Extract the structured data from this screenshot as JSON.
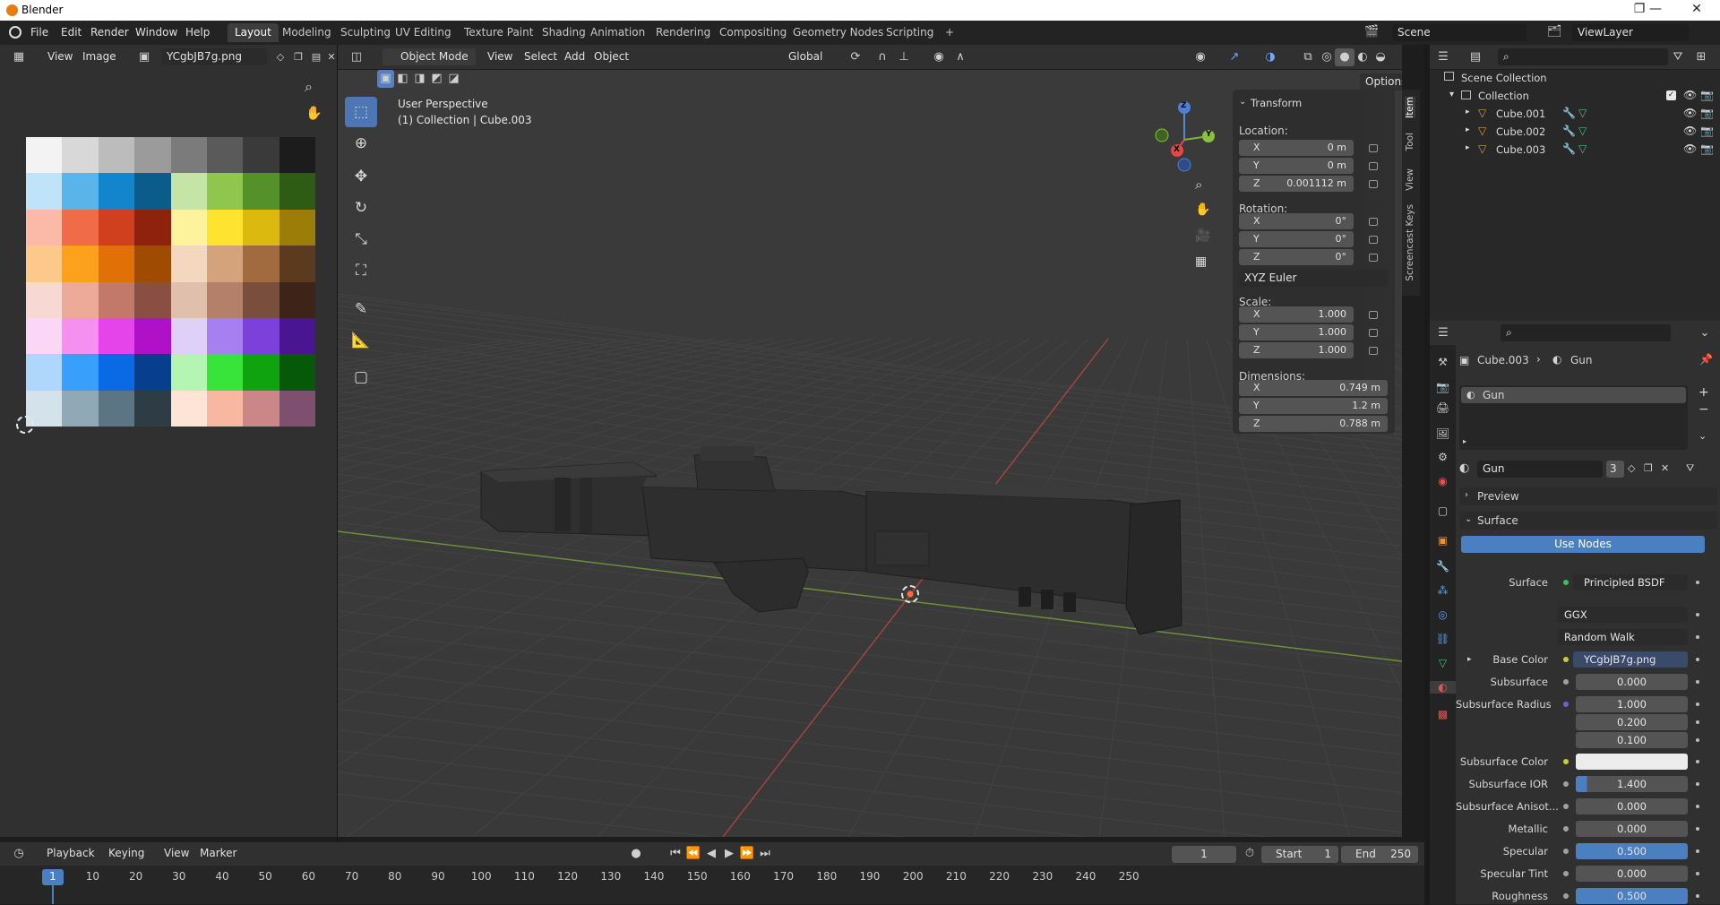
{
  "window": {
    "title": "Blender",
    "min": "—",
    "max": "❐",
    "close": "✕"
  },
  "menu": {
    "file": "File",
    "edit": "Edit",
    "render": "Render",
    "window": "Window",
    "help": "Help"
  },
  "workspaces": [
    "Layout",
    "Modeling",
    "Sculpting",
    "UV Editing",
    "Texture Paint",
    "Shading",
    "Animation",
    "Rendering",
    "Compositing",
    "Geometry Nodes",
    "Scripting"
  ],
  "workspace_add": "+",
  "scene": {
    "label": "Scene",
    "viewlayer": "ViewLayer"
  },
  "image_editor": {
    "view": "View",
    "image": "Image",
    "filename": "YCgbJB7g.png",
    "colors": [
      [
        "#f3f3f3",
        "#d8d8d8",
        "#bcbcbc",
        "#9b9b9b",
        "#7b7b7b",
        "#5a5a5a",
        "#3a3a3a",
        "#1c1c1c"
      ],
      [
        "#bfe3f9",
        "#59b4e9",
        "#1285cc",
        "#0b5b8b",
        "#c4e5a5",
        "#8ec64e",
        "#54912a",
        "#2e5c14"
      ],
      [
        "#fbb9a8",
        "#f06b47",
        "#d0401f",
        "#8e220c",
        "#fef39c",
        "#fee42e",
        "#dcb90e",
        "#9c7d07"
      ],
      [
        "#fdc98a",
        "#fca11b",
        "#e17006",
        "#a04b02",
        "#f3d8bf",
        "#d5a37b",
        "#a26b3f",
        "#5c3a1e"
      ],
      [
        "#f8d8d2",
        "#eeaa98",
        "#c2796a",
        "#8a4f42",
        "#e0c0ad",
        "#b4806a",
        "#7a4e3d",
        "#3e2418"
      ],
      [
        "#fbd6f6",
        "#f58ff0",
        "#e544ea",
        "#b010c8",
        "#dfd0f9",
        "#a67ff1",
        "#7c41db",
        "#4a1592"
      ],
      [
        "#afd6fc",
        "#38a0fb",
        "#0a6ae5",
        "#073e8e",
        "#b5f5b3",
        "#38e33a",
        "#0ea30f",
        "#07590a"
      ],
      [
        "#d4e3eb",
        "#8fa9b7",
        "#5b7585",
        "#2e3c45",
        "#fde4d5",
        "#f7b7a0",
        "#cb8788",
        "#7e4f6e"
      ]
    ]
  },
  "viewport": {
    "mode": "Object Mode",
    "view": "View",
    "select": "Select",
    "add": "Add",
    "object": "Object",
    "orientation": "Global",
    "options": "Options",
    "perspective": "User Perspective",
    "collection_info": "(1) Collection | Cube.003"
  },
  "gizmo": {
    "x": "X",
    "y": "Y",
    "z": "Z"
  },
  "npanel": {
    "tabs": [
      "Item",
      "Tool",
      "View",
      "Screencast Keys"
    ],
    "transform": "Transform",
    "location_label": "Location:",
    "loc": [
      {
        "ax": "X",
        "v": "0 m"
      },
      {
        "ax": "Y",
        "v": "0 m"
      },
      {
        "ax": "Z",
        "v": "0.001112 m"
      }
    ],
    "rotation_label": "Rotation:",
    "rot": [
      {
        "ax": "X",
        "v": "0°"
      },
      {
        "ax": "Y",
        "v": "0°"
      },
      {
        "ax": "Z",
        "v": "0°"
      }
    ],
    "rot_mode": "XYZ Euler",
    "scale_label": "Scale:",
    "scale": [
      {
        "ax": "X",
        "v": "1.000"
      },
      {
        "ax": "Y",
        "v": "1.000"
      },
      {
        "ax": "Z",
        "v": "1.000"
      }
    ],
    "dim_label": "Dimensions:",
    "dim": [
      {
        "ax": "X",
        "v": "0.749 m"
      },
      {
        "ax": "Y",
        "v": "1.2 m"
      },
      {
        "ax": "Z",
        "v": "0.788 m"
      }
    ]
  },
  "outliner": {
    "scene_collection": "Scene Collection",
    "collection": "Collection",
    "items": [
      "Cube.001",
      "Cube.002",
      "Cube.003"
    ]
  },
  "properties": {
    "breadcrumb_obj": "Cube.003",
    "breadcrumb_mat": "Gun",
    "slot": "Gun",
    "material_name": "Gun",
    "users": "3",
    "preview": "Preview",
    "surface_section": "Surface",
    "use_nodes": "Use Nodes",
    "rows": [
      {
        "label": "Surface",
        "value": "Principled BSDF",
        "type": "node"
      },
      {
        "label": "",
        "value": "GGX",
        "type": "dropdown"
      },
      {
        "label": "",
        "value": "Random Walk",
        "type": "dropdown"
      },
      {
        "label": "Base Color",
        "value": "YCgbJB7g.png",
        "type": "node"
      },
      {
        "label": "Subsurface",
        "value": "0.000",
        "type": "num"
      },
      {
        "label": "Subsurface Radius",
        "value": "1.000",
        "type": "num"
      },
      {
        "label": "",
        "value": "0.200",
        "type": "num"
      },
      {
        "label": "",
        "value": "0.100",
        "type": "num"
      },
      {
        "label": "Subsurface Color",
        "value": "",
        "type": "color"
      },
      {
        "label": "Subsurface IOR",
        "value": "1.400",
        "type": "num"
      },
      {
        "label": "Subsurface Anisot...",
        "value": "0.000",
        "type": "num"
      },
      {
        "label": "Metallic",
        "value": "0.000",
        "type": "num"
      },
      {
        "label": "Specular",
        "value": "0.500",
        "type": "blue"
      },
      {
        "label": "Specular Tint",
        "value": "0.000",
        "type": "num"
      },
      {
        "label": "Roughness",
        "value": "0.500",
        "type": "blue"
      }
    ]
  },
  "timeline": {
    "playback": "Playback",
    "keying": "Keying",
    "view": "View",
    "marker": "Marker",
    "current": "1",
    "start_label": "Start",
    "start": "1",
    "end_label": "End",
    "end": "250",
    "ticks": [
      "1",
      "10",
      "20",
      "30",
      "40",
      "50",
      "60",
      "70",
      "80",
      "90",
      "100",
      "110",
      "120",
      "130",
      "140",
      "150",
      "160",
      "170",
      "180",
      "190",
      "200",
      "210",
      "220",
      "230",
      "240",
      "250"
    ]
  }
}
